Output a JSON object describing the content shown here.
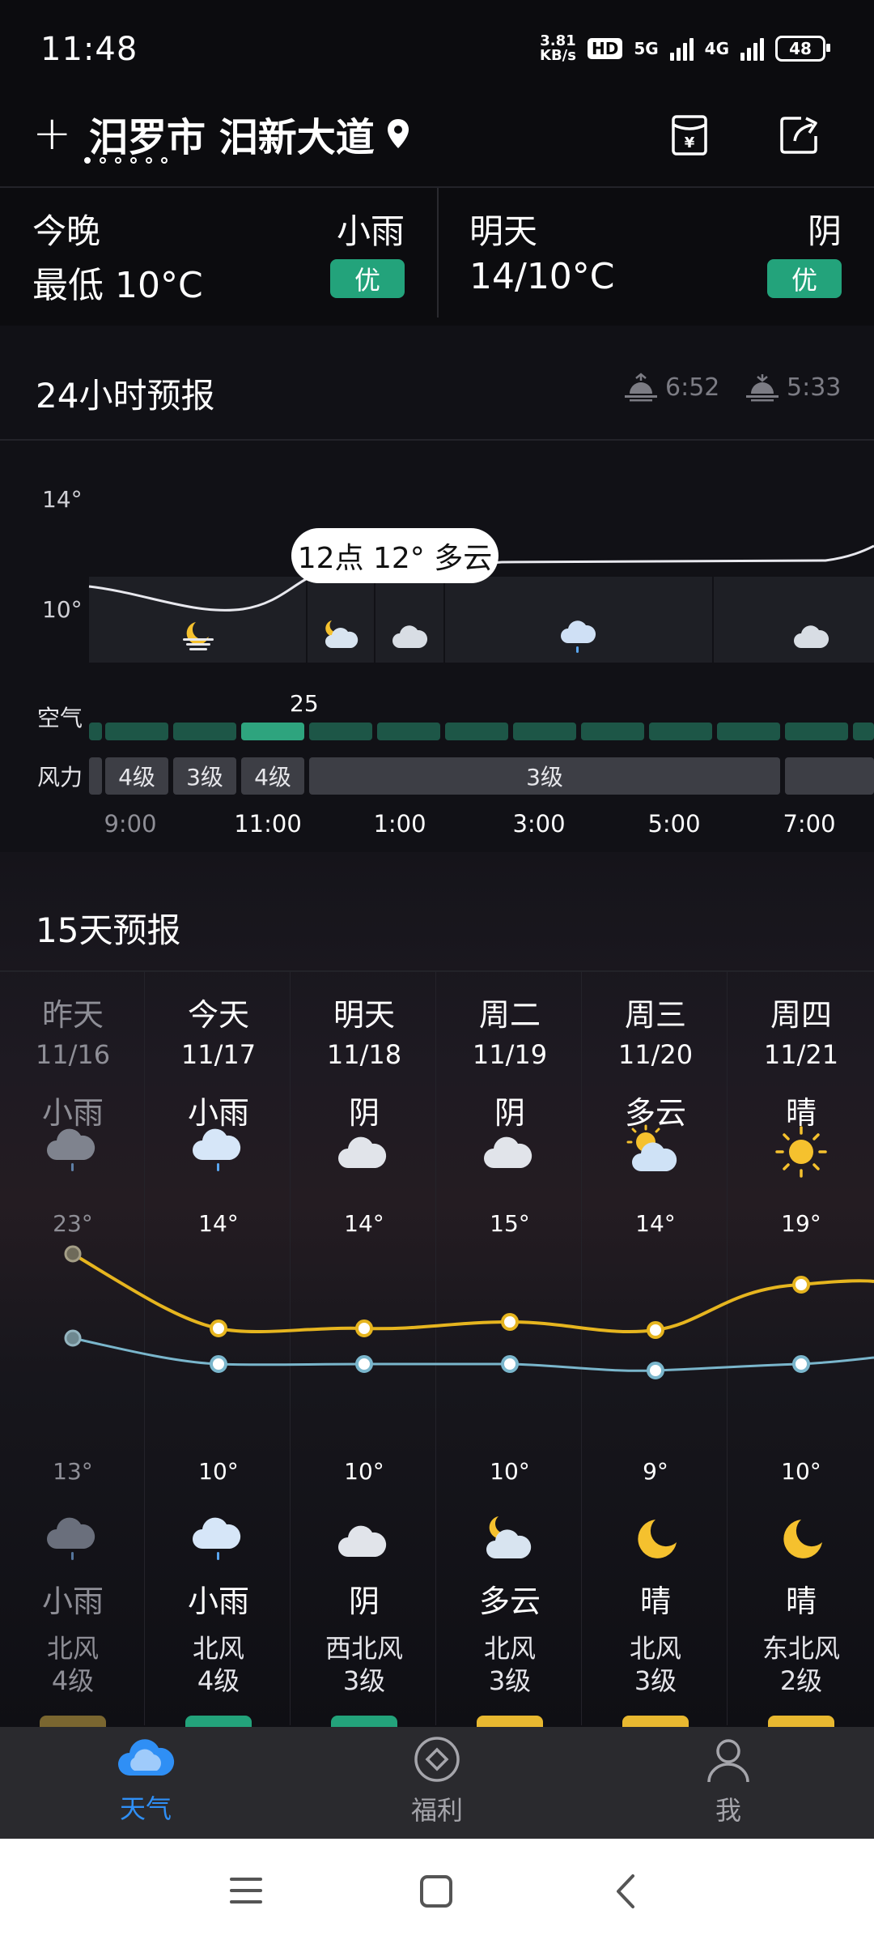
{
  "status_bar": {
    "time": "11:48",
    "net_speed_value": "3.81",
    "net_speed_unit": "KB/s",
    "hd_badge": "HD",
    "net1": "5G",
    "net2": "4G",
    "battery": "48"
  },
  "header": {
    "add_icon": "+",
    "location": "汨罗市 汨新大道",
    "page_count": 6,
    "active_page": 0
  },
  "summary": {
    "tonight": {
      "label": "今晚",
      "weather": "小雨",
      "temp": "最低 10°C",
      "aqi": "优"
    },
    "tomorrow": {
      "label": "明天",
      "weather": "阴",
      "temp": "14/10°C",
      "aqi": "优"
    }
  },
  "hourly": {
    "title": "24小时预报",
    "sunrise": "6:52",
    "sunset": "5:33",
    "y_high": "14°",
    "y_low": "10°",
    "tooltip": "12点 12° 多云",
    "aqi_label": "空气",
    "aqi_value": "25",
    "wind_label": "风力",
    "wind_segments": [
      "4级",
      "3级",
      "4级",
      "3级"
    ],
    "ticks": [
      "9:00",
      "11:00",
      "1:00",
      "3:00",
      "5:00",
      "7:00"
    ]
  },
  "daily": {
    "title": "15天预报",
    "days": [
      {
        "name": "昨天",
        "date": "11/16",
        "day_weather": "小雨",
        "high": "23°",
        "low": "13°",
        "night_weather": "小雨",
        "wind_dir": "北风",
        "wind_level": "4级",
        "aqi_color": "#7a6630",
        "past": true
      },
      {
        "name": "今天",
        "date": "11/17",
        "day_weather": "小雨",
        "high": "14°",
        "low": "10°",
        "night_weather": "小雨",
        "wind_dir": "北风",
        "wind_level": "4级",
        "aqi_color": "#23a37b",
        "past": false
      },
      {
        "name": "明天",
        "date": "11/18",
        "day_weather": "阴",
        "high": "14°",
        "low": "10°",
        "night_weather": "阴",
        "wind_dir": "西北风",
        "wind_level": "3级",
        "aqi_color": "#23a37b",
        "past": false
      },
      {
        "name": "周二",
        "date": "11/19",
        "day_weather": "阴",
        "high": "15°",
        "low": "10°",
        "night_weather": "多云",
        "wind_dir": "北风",
        "wind_level": "3级",
        "aqi_color": "#e8b830",
        "past": false
      },
      {
        "name": "周三",
        "date": "11/20",
        "day_weather": "多云",
        "high": "14°",
        "low": "9°",
        "night_weather": "晴",
        "wind_dir": "北风",
        "wind_level": "3级",
        "aqi_color": "#e8b830",
        "past": false
      },
      {
        "name": "周四",
        "date": "11/21",
        "day_weather": "晴",
        "high": "19°",
        "low": "10°",
        "night_weather": "晴",
        "wind_dir": "东北风",
        "wind_level": "2级",
        "aqi_color": "#e8b830",
        "past": false
      }
    ]
  },
  "bottom_nav": {
    "items": [
      {
        "label": "天气",
        "active": true
      },
      {
        "label": "福利",
        "active": false
      },
      {
        "label": "我",
        "active": false
      }
    ]
  },
  "colors": {
    "accent": "#2f8ff5",
    "aqi_good": "#23a37b",
    "high_line": "#e6b51f",
    "low_line": "#7ab6cc"
  }
}
